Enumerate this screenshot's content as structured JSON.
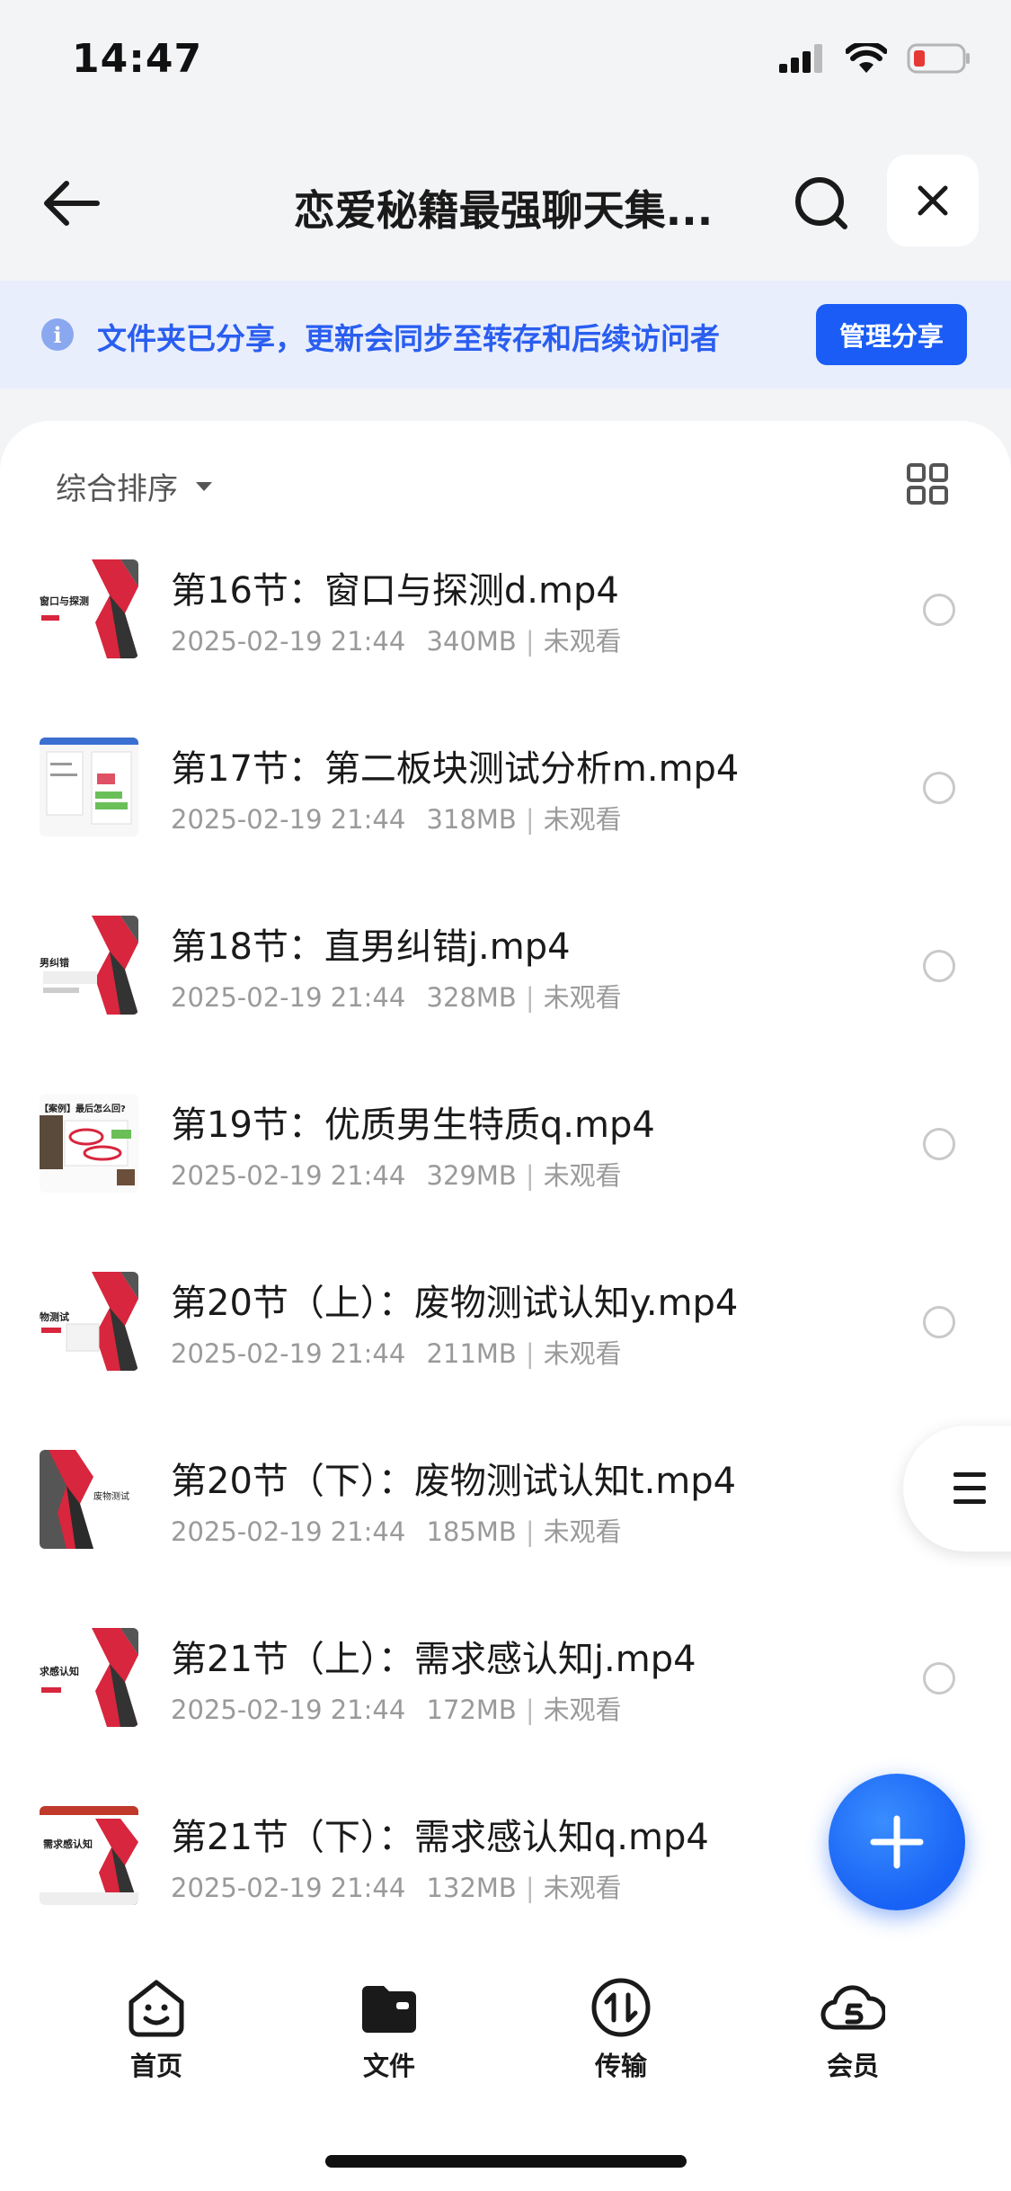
{
  "status_bar": {
    "time": "14:47"
  },
  "header": {
    "title": "恋爱秘籍最强聊天集..."
  },
  "banner": {
    "text": "文件夹已分享，更新会同步至转存和后续访问者",
    "button": "管理分享"
  },
  "sort": {
    "label": "综合排序"
  },
  "files": [
    {
      "name": "第16节：窗口与探测d.mp4",
      "date": "2025-02-19 21:44",
      "size": "340MB",
      "status": "未观看",
      "thumb_text": "窗口与探测"
    },
    {
      "name": "第17节：第二板块测试分析m.mp4",
      "date": "2025-02-19 21:44",
      "size": "318MB",
      "status": "未观看",
      "thumb_text": ""
    },
    {
      "name": "第18节：直男纠错j.mp4",
      "date": "2025-02-19 21:44",
      "size": "328MB",
      "status": "未观看",
      "thumb_text": "男纠错"
    },
    {
      "name": "第19节：优质男生特质q.mp4",
      "date": "2025-02-19 21:44",
      "size": "329MB",
      "status": "未观看",
      "thumb_text": "【案例】最后怎么回?"
    },
    {
      "name": "第20节（上）：废物测试认知y.mp4",
      "date": "2025-02-19 21:44",
      "size": "211MB",
      "status": "未观看",
      "thumb_text": "物测试"
    },
    {
      "name": "第20节（下）：废物测试认知t.mp4",
      "date": "2025-02-19 21:44",
      "size": "185MB",
      "status": "未观看",
      "thumb_text": "废物测试"
    },
    {
      "name": "第21节（上）：需求感认知j.mp4",
      "date": "2025-02-19 21:44",
      "size": "172MB",
      "status": "未观看",
      "thumb_text": "求感认知"
    },
    {
      "name": "第21节（下）：需求感认知q.mp4",
      "date": "2025-02-19 21:44",
      "size": "132MB",
      "status": "未观看",
      "thumb_text": "需求感认知"
    }
  ],
  "nav": [
    {
      "label": "首页",
      "icon": "home-smile-icon"
    },
    {
      "label": "文件",
      "icon": "folder-icon"
    },
    {
      "label": "传输",
      "icon": "transfer-icon"
    },
    {
      "label": "会员",
      "icon": "vip-cloud-icon"
    }
  ],
  "colors": {
    "accent": "#1a5cf5",
    "banner_bg": "#e9eefc",
    "banner_text": "#2a5ef0",
    "battery_low": "#e53935"
  }
}
